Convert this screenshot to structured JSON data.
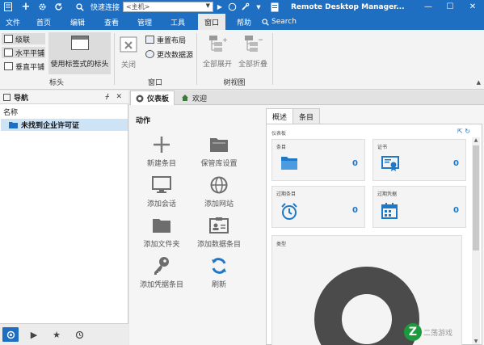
{
  "titlebar": {
    "search_label": "快速连接",
    "host_placeholder": "<主机>",
    "app_title": "Remote Desktop Manager..."
  },
  "menu": {
    "items": [
      "文件",
      "首页",
      "编辑",
      "查看",
      "管理",
      "工具",
      "窗口",
      "帮助"
    ],
    "active": "窗口",
    "search_label": "Search"
  },
  "ribbon": {
    "layout": {
      "cascade": "级联",
      "tile_horizontal": "水平平铺",
      "tile_vertical": "垂直平铺",
      "tabbed_header": "使用标签式的标头",
      "group_label": "标头"
    },
    "window": {
      "close": "关闭",
      "reset_layout": "重置布局",
      "change_datasource": "更改数据源",
      "group_label": "窗口"
    },
    "tree": {
      "expand_all": "全部展开",
      "collapse_all": "全部折叠",
      "group_label": "树视图"
    }
  },
  "nav": {
    "title": "导航",
    "column_header": "名称",
    "item": "未找到企业许可证"
  },
  "tabs": {
    "dashboard": "仪表板",
    "welcome": "欢迎"
  },
  "actions": {
    "title": "动作",
    "items": [
      {
        "label": "新建条目",
        "icon": "plus-icon"
      },
      {
        "label": "保管库设置",
        "icon": "vault-folder-icon"
      },
      {
        "label": "添加会话",
        "icon": "monitor-icon"
      },
      {
        "label": "添加网站",
        "icon": "globe-icon"
      },
      {
        "label": "添加文件夹",
        "icon": "folder-icon"
      },
      {
        "label": "添加数据条目",
        "icon": "contact-card-icon"
      },
      {
        "label": "添加凭据条目",
        "icon": "key-icon"
      },
      {
        "label": "刷新",
        "icon": "refresh-icon"
      }
    ]
  },
  "dashboard": {
    "tabs": [
      "概述",
      "条目"
    ],
    "active_tab": "概述",
    "panel_title": "仪表板",
    "cards": [
      {
        "title": "条目",
        "value": "0",
        "icon": "folder-icon"
      },
      {
        "title": "证书",
        "value": "0",
        "icon": "certificate-icon"
      },
      {
        "title": "过期条目",
        "value": "0",
        "icon": "alarm-clock-icon"
      },
      {
        "title": "过期凭据",
        "value": "0",
        "icon": "calendar-icon"
      }
    ],
    "type_card_title": "类型",
    "donut_color": "#4b4b4b"
  },
  "watermark": {
    "text": "二荡游戏"
  },
  "colors": {
    "accent": "#1e6fc1",
    "value_blue": "#1e78c8",
    "selection": "#cde4f7"
  }
}
